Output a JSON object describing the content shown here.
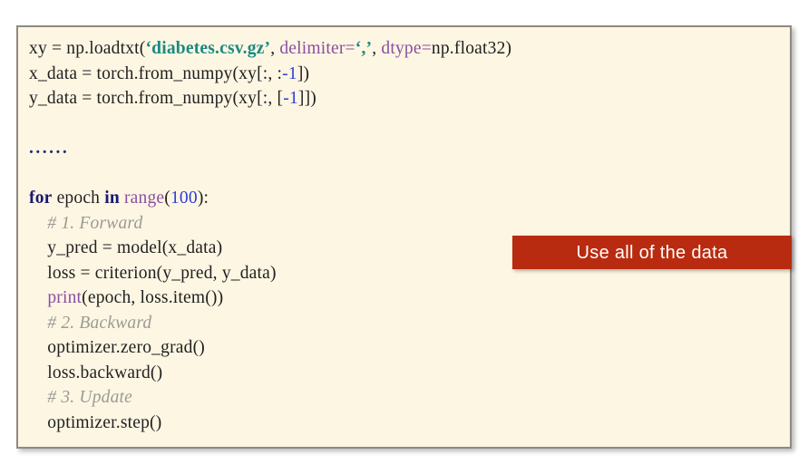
{
  "slide": {
    "background_color": "#ffffff"
  },
  "code_panel": {
    "background_color": "#fdf6e3",
    "border_color": "#8d8a80",
    "language": "python",
    "lines": [
      {
        "id": "line-1",
        "tokens": [
          {
            "text": "xy = np.loadtxt(",
            "type": "plain"
          },
          {
            "text": "‘diabetes.csv.gz’",
            "type": "string"
          },
          {
            "text": ", ",
            "type": "plain"
          },
          {
            "text": "delimiter=",
            "type": "kwarg"
          },
          {
            "text": "‘,’",
            "type": "string"
          },
          {
            "text": ", ",
            "type": "plain"
          },
          {
            "text": "dtype=",
            "type": "kwarg"
          },
          {
            "text": "np.float32)",
            "type": "plain"
          }
        ]
      },
      {
        "id": "line-2",
        "tokens": [
          {
            "text": "x_data = torch.from_numpy(xy[:, :",
            "type": "plain"
          },
          {
            "text": "-1",
            "type": "number"
          },
          {
            "text": "])",
            "type": "plain"
          }
        ]
      },
      {
        "id": "line-3",
        "tokens": [
          {
            "text": "y_data = torch.from_numpy(xy[:, [",
            "type": "plain"
          },
          {
            "text": "-1",
            "type": "number"
          },
          {
            "text": "]])",
            "type": "plain"
          }
        ]
      },
      {
        "id": "line-4",
        "tokens": []
      },
      {
        "id": "line-5",
        "tokens": [
          {
            "text": "......",
            "type": "dots"
          }
        ]
      },
      {
        "id": "line-6",
        "tokens": []
      },
      {
        "id": "line-7",
        "tokens": [
          {
            "text": "for",
            "type": "keyword"
          },
          {
            "text": " epoch ",
            "type": "plain"
          },
          {
            "text": "in",
            "type": "keyword"
          },
          {
            "text": " ",
            "type": "plain"
          },
          {
            "text": "range",
            "type": "builtin"
          },
          {
            "text": "(",
            "type": "plain"
          },
          {
            "text": "100",
            "type": "number"
          },
          {
            "text": "):",
            "type": "plain"
          }
        ]
      },
      {
        "id": "line-8",
        "tokens": [
          {
            "text": "    # 1. Forward",
            "type": "comment"
          }
        ]
      },
      {
        "id": "line-9",
        "tokens": [
          {
            "text": "    y_pred = model(x_data)",
            "type": "plain"
          }
        ]
      },
      {
        "id": "line-10",
        "tokens": [
          {
            "text": "    loss = criterion(y_pred, y_data)",
            "type": "plain"
          }
        ]
      },
      {
        "id": "line-11",
        "tokens": [
          {
            "text": "    ",
            "type": "plain"
          },
          {
            "text": "print",
            "type": "builtin"
          },
          {
            "text": "(epoch, loss.item())",
            "type": "plain"
          }
        ]
      },
      {
        "id": "line-12",
        "tokens": [
          {
            "text": "    # 2. Backward",
            "type": "comment"
          }
        ]
      },
      {
        "id": "line-13",
        "tokens": [
          {
            "text": "    optimizer.zero_grad()",
            "type": "plain"
          }
        ]
      },
      {
        "id": "line-14",
        "tokens": [
          {
            "text": "    loss.backward()",
            "type": "plain"
          }
        ]
      },
      {
        "id": "line-15",
        "tokens": [
          {
            "text": "    # 3. Update",
            "type": "comment"
          }
        ]
      },
      {
        "id": "line-16",
        "tokens": [
          {
            "text": "    optimizer.step()",
            "type": "plain"
          }
        ]
      }
    ],
    "token_colors": {
      "plain": "#1f1f1f",
      "string": "#1a8a82",
      "kwarg": "#8a4f9e",
      "builtin": "#8a4f9e",
      "number": "#2b3ed6",
      "keyword": "#1a1a6e",
      "comment": "#9b9b93",
      "dots": "#23306e"
    }
  },
  "callout": {
    "label": "Use all of the data",
    "background_color": "#b92b10",
    "text_color": "#ffffff"
  }
}
